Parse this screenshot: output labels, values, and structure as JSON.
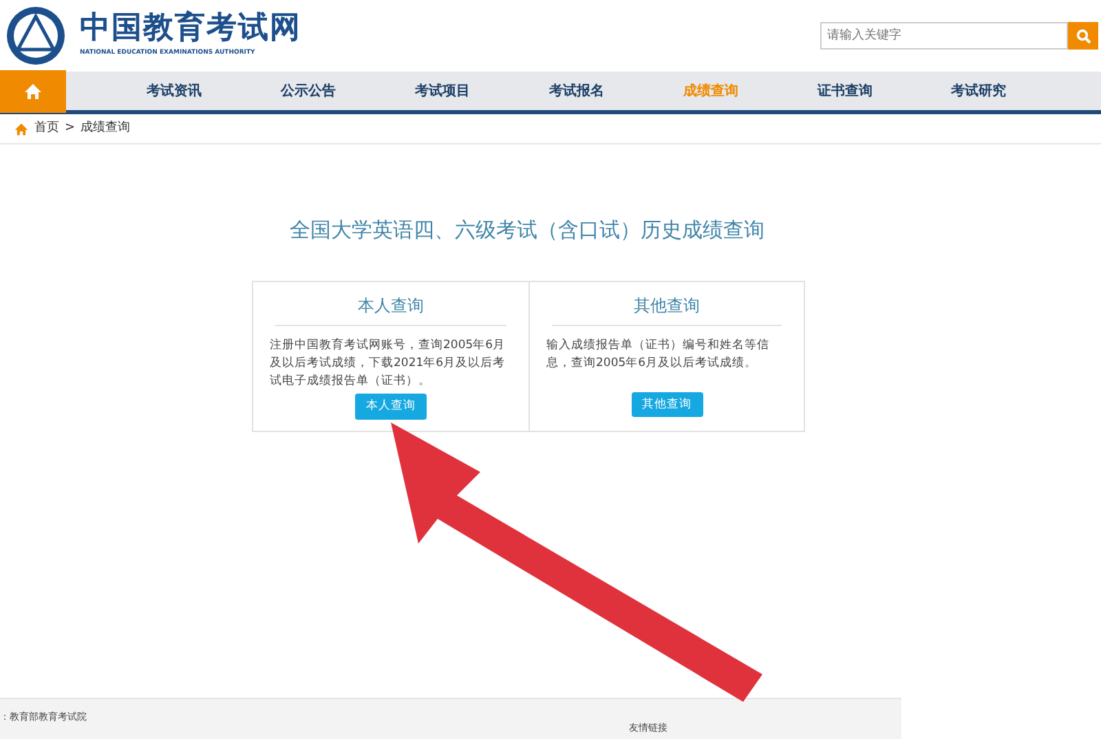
{
  "header": {
    "logo_title": "中国教育考试网",
    "logo_subtitle": "NATIONAL EDUCATION EXAMINATIONS AUTHORITY",
    "search": {
      "placeholder": "请输入关键字"
    }
  },
  "nav": [
    {
      "label": "考试资讯",
      "selected": false
    },
    {
      "label": "公示公告",
      "selected": false
    },
    {
      "label": "考试项目",
      "selected": false
    },
    {
      "label": "考试报名",
      "selected": false
    },
    {
      "label": "成绩查询",
      "selected": true
    },
    {
      "label": "证书查询",
      "selected": false
    },
    {
      "label": "考试研究",
      "selected": false
    }
  ],
  "breadcrumb": [
    "首页",
    ">",
    "成绩查询"
  ],
  "page_title": "全国大学英语四、六级考试（含口试）历史成绩查询",
  "options": [
    {
      "title": "本人查询",
      "description": "注册中国教育考试网账号，查询2005年6月及以后考试成绩，下载2021年6月及以后考试电子成绩报告单（证书）。",
      "button": "本人查询"
    },
    {
      "title": "其他查询",
      "description": "输入成绩报告单（证书）编号和姓名等信息，查询2005年6月及以后考试成绩。",
      "button": "其他查询"
    }
  ],
  "footer": {
    "left": "：教育部教育考试院",
    "right": "友情链接"
  }
}
